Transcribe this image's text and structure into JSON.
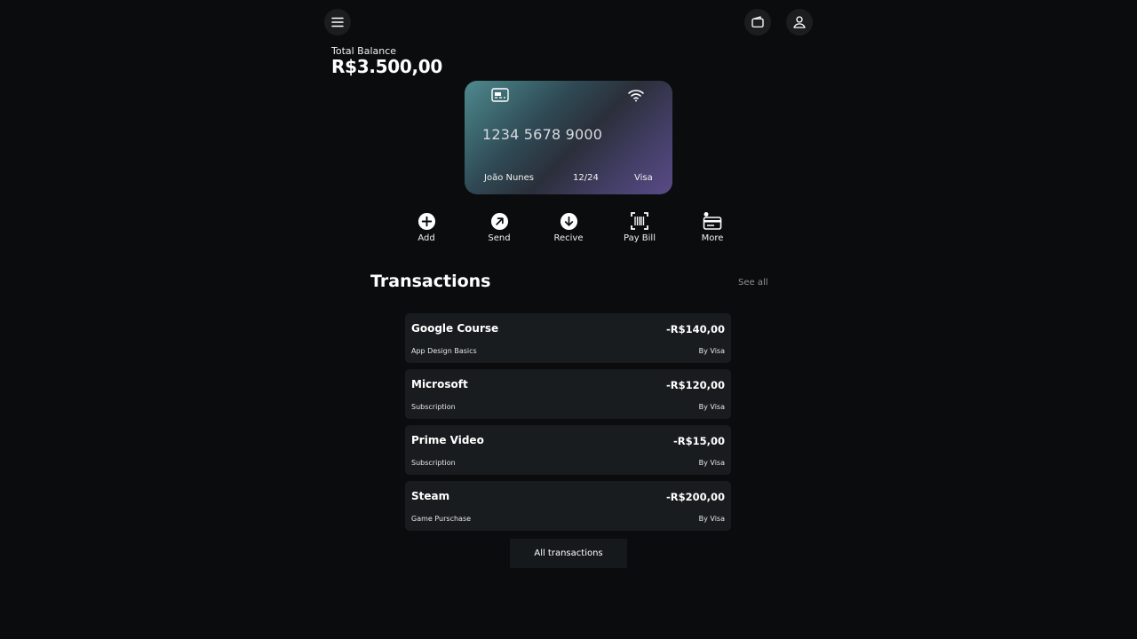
{
  "header": {
    "menu_icon": "hamburger-menu-icon",
    "wallet_icon": "wallet-icon",
    "profile_icon": "user-icon"
  },
  "balance": {
    "label": "Total Balance",
    "value": "R$3.500,00"
  },
  "card": {
    "number": "1234 5678 9000",
    "holder": "João Nunes",
    "expiry": "12/24",
    "brand": "Visa",
    "chip_icon": "card-chip-icon",
    "contactless_icon": "wifi-icon"
  },
  "actions": [
    {
      "label": "Add",
      "icon": "plus-circle-icon"
    },
    {
      "label": "Send",
      "icon": "arrow-up-right-circle-icon"
    },
    {
      "label": "Recive",
      "icon": "arrow-down-circle-icon"
    },
    {
      "label": "Pay Bill",
      "icon": "barcode-scan-icon"
    },
    {
      "label": "More",
      "icon": "card-list-icon"
    }
  ],
  "transactions": {
    "title": "Transactions",
    "see_all": "See all",
    "items": [
      {
        "name": "Google Course",
        "amount": "-R$140,00",
        "description": "App Design Basics",
        "via": "By Visa"
      },
      {
        "name": "Microsoft",
        "amount": "-R$120,00",
        "description": "Subscription",
        "via": "By Visa"
      },
      {
        "name": "Prime Video",
        "amount": "-R$15,00",
        "description": "Subscription",
        "via": "By Visa"
      },
      {
        "name": "Steam",
        "amount": "-R$200,00",
        "description": "Game Purschase",
        "via": "By Visa"
      }
    ],
    "all_button": "All transactions"
  }
}
